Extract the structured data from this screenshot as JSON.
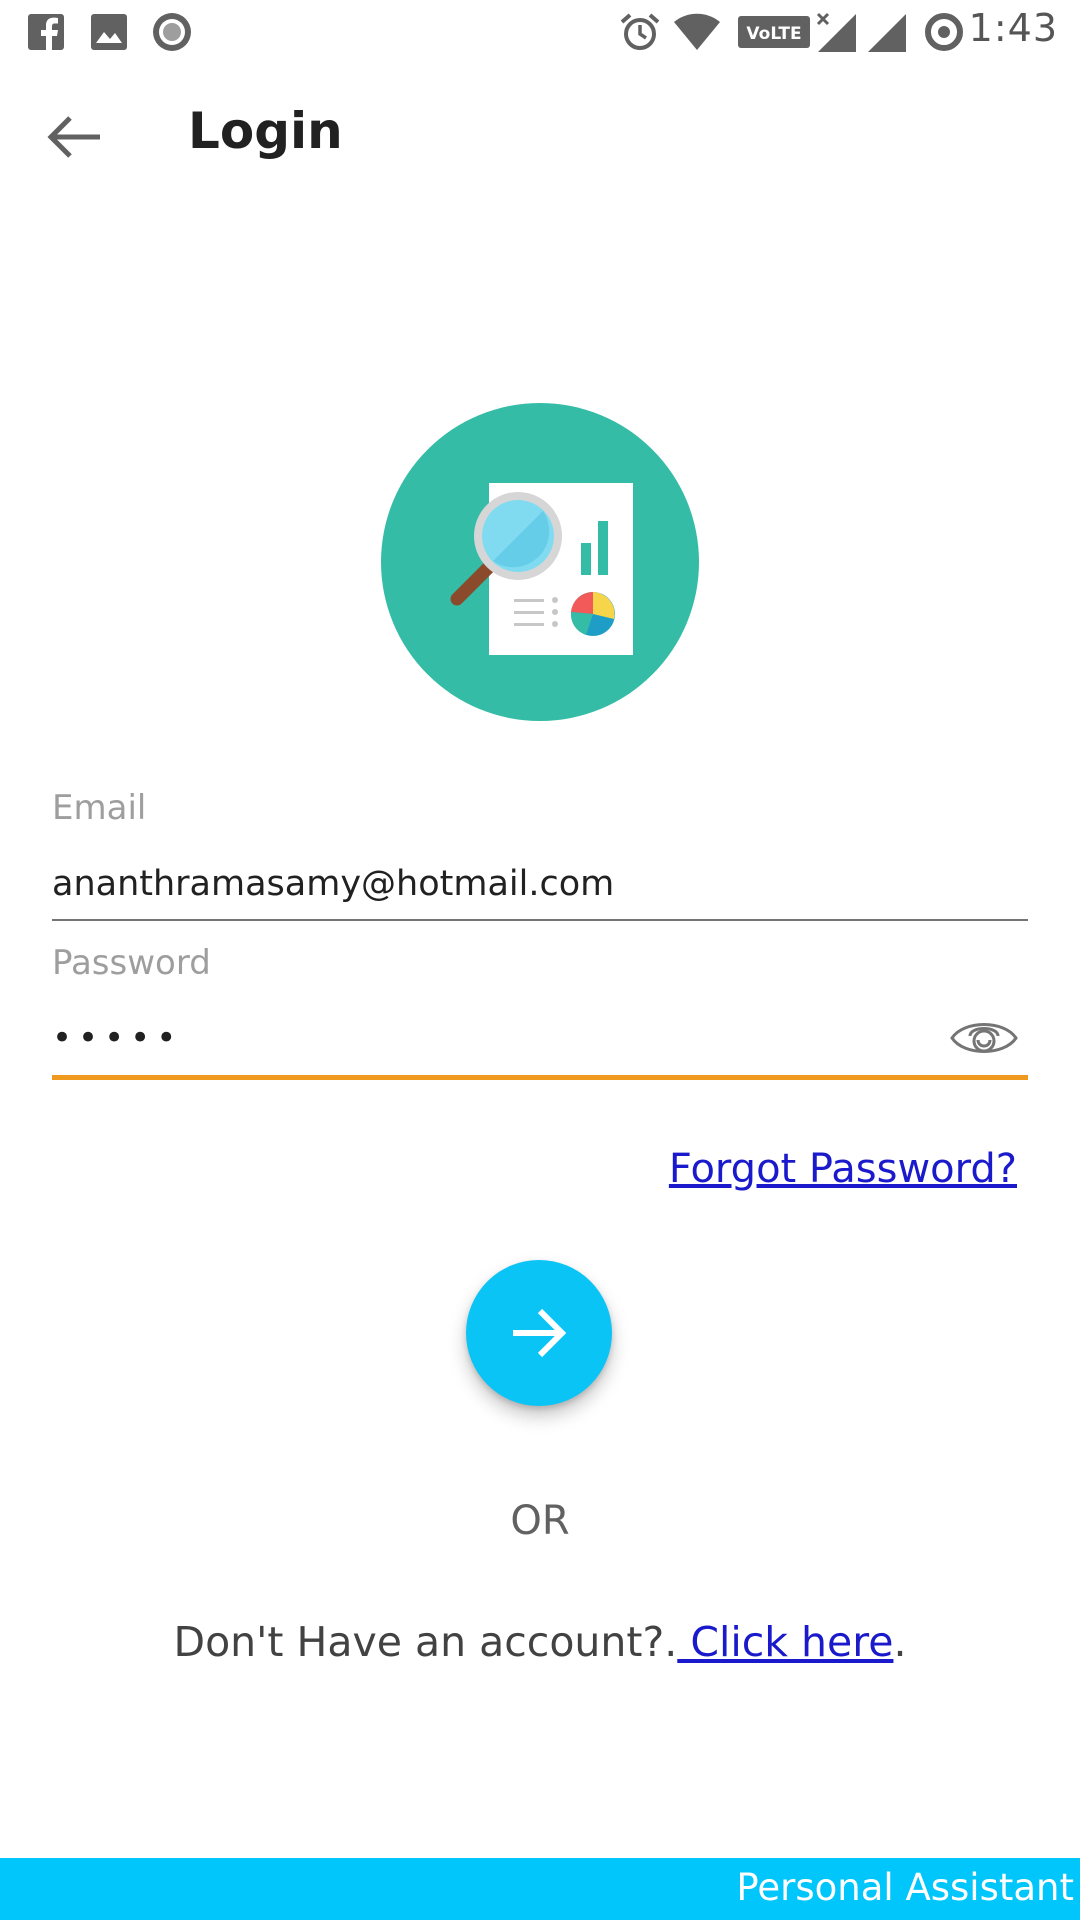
{
  "status_bar": {
    "time": "1:43",
    "left_icons": [
      "facebook-icon",
      "gallery-icon",
      "record-icon"
    ],
    "right_icons": [
      "alarm-icon",
      "wifi-icon",
      "volte-icon",
      "signal-no-data-icon",
      "signal-icon",
      "data-saver-icon"
    ],
    "volte_label": "VoLTE"
  },
  "app_bar": {
    "title": "Login",
    "back_icon": "arrow-left-icon"
  },
  "logo": {
    "icon": "analytics-report-icon",
    "colors": {
      "circle": "#35bca6",
      "paper": "#ffffff",
      "lens": "#80dbf0",
      "handle": "#8b4a2b"
    }
  },
  "form": {
    "email": {
      "label": "Email",
      "value": "ananthramasamy@hotmail.com"
    },
    "password": {
      "label": "Password",
      "value": "•••••",
      "toggle_icon": "eye-icon"
    },
    "forgot_password": "Forgot Password?",
    "submit_icon": "arrow-right-icon"
  },
  "separator": "OR",
  "signup": {
    "prompt": "Don't Have an account?.",
    "link": " Click here",
    "suffix": "."
  },
  "footer": {
    "text": "Personal Assistant"
  },
  "colors": {
    "accent": "#0ac4f6",
    "footer": "#00c6fb",
    "focus_underline": "#ef9a1f",
    "link": "#1a1acc"
  }
}
